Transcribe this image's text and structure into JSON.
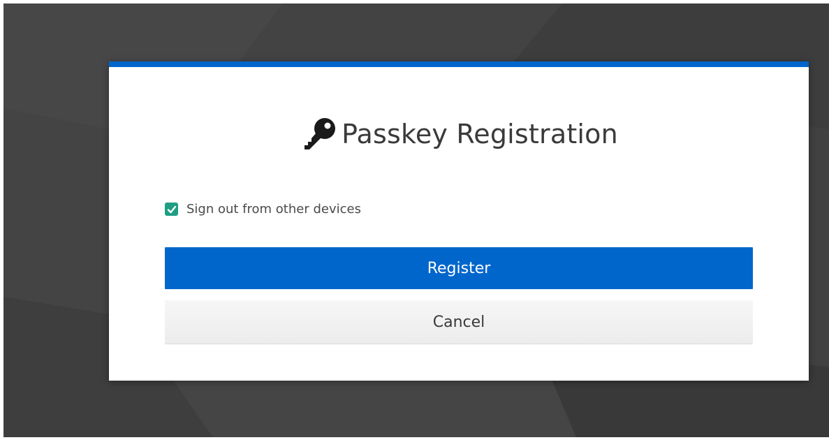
{
  "dialog": {
    "title": "Passkey Registration",
    "icon": "key-icon",
    "accent_color": "#0066cc"
  },
  "options": {
    "sign_out_label": "Sign out from other devices",
    "sign_out_checked": true,
    "checkbox_color": "#1f9e84"
  },
  "actions": {
    "register_label": "Register",
    "cancel_label": "Cancel"
  }
}
